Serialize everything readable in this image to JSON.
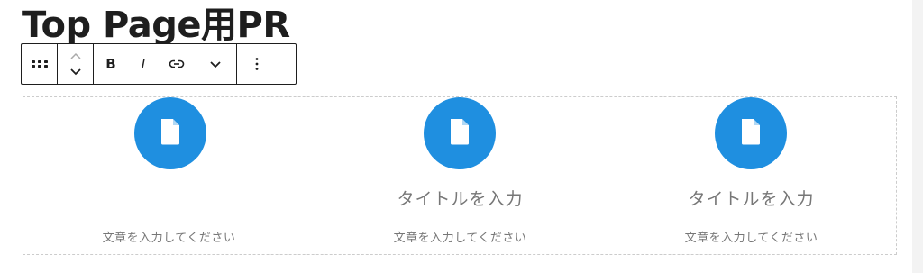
{
  "heading": {
    "text": "Top Page用PR"
  },
  "toolbar": {
    "block_type_icon": "drag-handle-icon",
    "move_icon": "move-up-down-icon",
    "bold_label": "B",
    "italic_label": "I",
    "link_icon": "link-icon",
    "more_formats_icon": "chevron-down-icon",
    "options_icon": "more-vertical-icon"
  },
  "features": {
    "items": [
      {
        "icon": "document-icon",
        "title": "",
        "text": "文章を入力してください"
      },
      {
        "icon": "document-icon",
        "title": "タイトルを入力",
        "text": "文章を入力してください"
      },
      {
        "icon": "document-icon",
        "title": "タイトルを入力",
        "text": "文章を入力してください"
      }
    ]
  },
  "colors": {
    "accent": "#1f8fe0",
    "text_dark": "#1e1e1e",
    "placeholder": "#777777",
    "dashed_border": "#cccccc"
  }
}
